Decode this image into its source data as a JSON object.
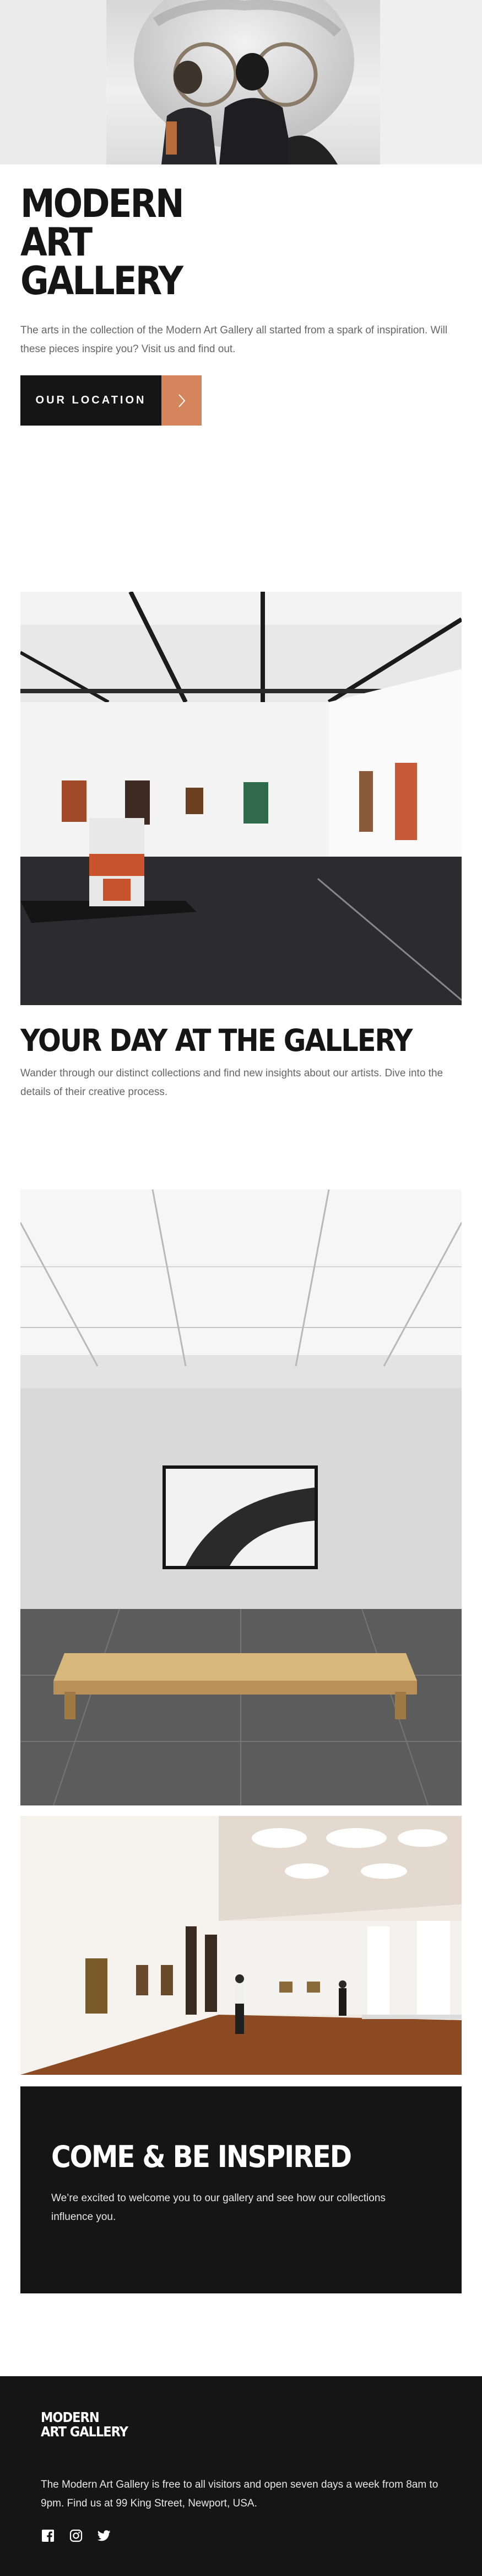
{
  "hero": {
    "title": "MODERN ART GALLERY",
    "description": "The arts in the collection of the Modern Art Gallery all started from a spark of inspiration. Will these pieces inspire you? Visit us and find out.",
    "cta_label": "OUR LOCATION"
  },
  "day": {
    "title": "YOUR DAY AT THE GALLERY",
    "description": "Wander through our distinct collections and find new insights about our artists. Dive into the details of their creative process."
  },
  "inspire": {
    "title": "COME & BE INSPIRED",
    "description": "We’re excited to welcome you to our gallery and see how our collections influence you."
  },
  "footer": {
    "logo": "MODERN ART GALLERY",
    "description": "The Modern Art Gallery is free to all visitors and open seven days a week from 8am to 9pm. Find us at 99 King Street, Newport, USA.",
    "socials": [
      "facebook-icon",
      "instagram-icon",
      "twitter-icon"
    ]
  },
  "colors": {
    "dark": "#151515",
    "accent": "#d5855b",
    "body_text": "#666666"
  }
}
